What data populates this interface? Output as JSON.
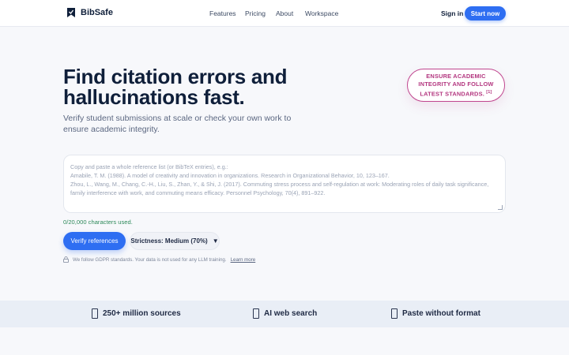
{
  "nav": {
    "brand": "BibSafe",
    "links": [
      "Features",
      "Pricing",
      "About",
      "Workspace"
    ],
    "signin": "Sign in",
    "start": "Start now"
  },
  "hero": {
    "title": "Find citation errors and hallucinations fast.",
    "subtitle": "Verify student submissions at scale or check your own work to ensure academic integrity.",
    "badge": "ENSURE ACADEMIC INTEGRITY AND FOLLOW LATEST STANDARDS.",
    "badge_ref": "[1]"
  },
  "input": {
    "placeholder_lines": [
      "Copy and paste a whole reference list (or BibTeX entries), e.g.:",
      "Amabile, T. M. (1988). A model of creativity and innovation in organizations. Research in Organizational Behavior, 10, 123–167.",
      "Zhou, L., Wang, M., Chang, C.-H., Liu, S., Zhan, Y., & Shi, J. (2017). Commuting stress process and self-regulation at work: Moderating roles of daily task significance, family interference with work, and commuting means efficacy. Personnel Psychology, 70(4), 891–922."
    ],
    "char_count": "0/20,000 characters used."
  },
  "actions": {
    "verify": "Verify references",
    "strictness": "Strictness: Medium (70%)",
    "gdpr": "We follow GDPR standards. Your data is not used for any LLM training.",
    "learn_more": "Learn more"
  },
  "features": [
    {
      "label": "250+ million sources",
      "icon": "document-icon"
    },
    {
      "label": "AI web search",
      "icon": "document-icon"
    },
    {
      "label": "Paste without format",
      "icon": "document-icon"
    }
  ],
  "colors": {
    "accent": "#2e6ef2",
    "badge": "#b3367f",
    "success": "#2f8a5b"
  }
}
